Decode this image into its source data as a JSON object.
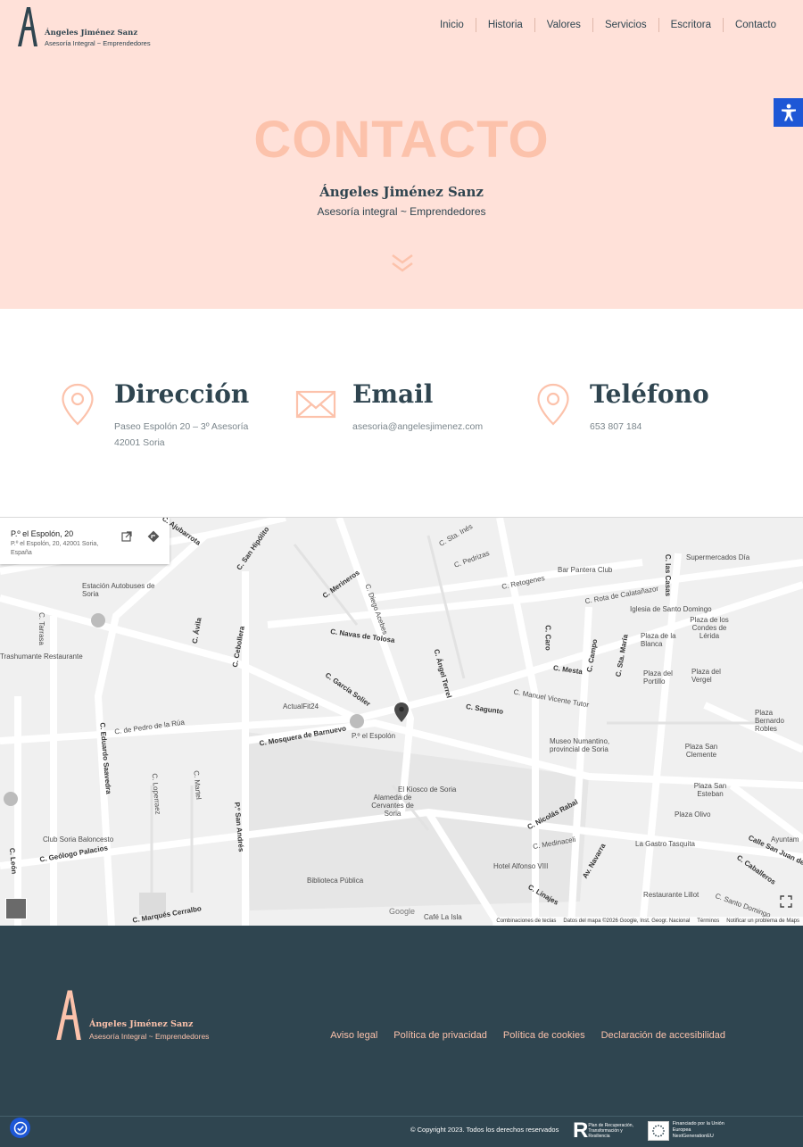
{
  "brand": {
    "name": "Ángeles Jiménez Sanz",
    "tagline": "Asesoría Integral ~ Emprendedores"
  },
  "nav": {
    "items": [
      "Inicio",
      "Historia",
      "Valores",
      "Servicios",
      "Escritora",
      "Contacto"
    ]
  },
  "hero": {
    "title": "CONTACTO",
    "name": "Ángeles Jiménez Sanz",
    "subtitle": "Asesoría integral ~ Emprendedores"
  },
  "contact": {
    "address": {
      "heading": "Dirección",
      "line1": "Paseo Espolón 20 – 3º Asesoría",
      "line2": "42001 Soria"
    },
    "email": {
      "heading": "Email",
      "value": "asesoria@angelesjimenez.com"
    },
    "phone": {
      "heading": "Teléfono",
      "value": "653 807 184"
    }
  },
  "map": {
    "card_title": "P.º el Espolón, 20",
    "card_address": "P.º el Espolón, 20, 42001 Soria, España",
    "labels": {
      "l01": "C. Ajubarrota",
      "l02": "C. San Hipólito",
      "l03": "C. Merineros",
      "l04": "C. Diego Acebes",
      "l05": "C. Sta. Inés",
      "l06": "C. Pedrizas",
      "l07": "C. Retogenes",
      "l08": "Bar Pantera Club",
      "l09": "C. Rota de Calatañazor",
      "l10": "C. las Casas",
      "l11": "Supermercados Día",
      "l12": "Iglesia de Santo Domingo",
      "l13": "Estación Autobuses de Soria",
      "l14": "C. Tarrasa",
      "l15": "Trashumante Restaurante",
      "l16": "C. Ávila",
      "l17": "C. Cebollera",
      "l18": "C. Navas de Tolosa",
      "l19": "C. Ángel Terrel",
      "l20": "C. Caro",
      "l21": "C. Mesta",
      "l22": "C. Campo",
      "l23": "C. Sta. María",
      "l24": "Plaza de los Condes de Lérida",
      "l25": "Plaza de la Blanca",
      "l26": "Plaza del Portillo",
      "l27": "Plaza del Vergel",
      "l28": "C. García Solier",
      "l29": "ActualFit24",
      "l30": "C. Sagunto",
      "l31": "C. Manuel Vicente Tutor",
      "l32": "Plaza Bernardo Robles",
      "l33": "C. de Pedro de la Rúa",
      "l34": "C. Eduardo Saavedra",
      "l35": "C. Mosquera de Barnuevo",
      "l36": "P.º el Espolón",
      "l37": "Museo Numantino, provincial de Soria",
      "l38": "Plaza San Clemente",
      "l39": "C. Loperraez",
      "l40": "C. Martel",
      "l41": "El Kiosco de Soria",
      "l42": "Alameda de Cervantes de Soria",
      "l43": "Plaza San Esteban",
      "l44": "C. Nicolás Rabal",
      "l45": "Plaza Olivo",
      "l46": "Club Soria Baloncesto",
      "l47": "P.º San Andrés",
      "l48": "C. Geólogo Palacios",
      "l49": "C. Medinaceli",
      "l50": "La Gastro Tasquita",
      "l51": "Calle San Juan de",
      "l52": "Hotel Alfonso VIII",
      "l53": "Av. Navarra",
      "l54": "C. Caballeros",
      "l55": "Biblioteca Pública",
      "l56": "C. Linajes",
      "l57": "Restaurante Lillot",
      "l58": "C. Marqués Cerralbo",
      "l59": "Café La Isla",
      "l60": "C. León",
      "l61": "C. Santo Domingo",
      "l62": "Ayuntam"
    },
    "google": "Google",
    "footer": [
      "Combinaciones de teclas",
      "Datos del mapa ©2026 Google, Inst. Geogr. Nacional",
      "Términos",
      "Notificar un problema de Maps"
    ]
  },
  "footer": {
    "links": [
      "Aviso legal",
      "Política de privacidad",
      "Política de cookies",
      "Declaración de accesibilidad"
    ],
    "copyright": "© Copyright 2023. Todos los derechos reservados",
    "badge_r_text": "Plan de Recuperación, Transformación y Resiliencia",
    "badge_eu_line1": "Financiado por la Unión Europea",
    "badge_eu_line2": "NextGenerationEU"
  },
  "colors": {
    "peach": "#ffe1d9",
    "salmon": "#fcc2ab",
    "navy": "#2f4550",
    "blue": "#1e57d6"
  }
}
